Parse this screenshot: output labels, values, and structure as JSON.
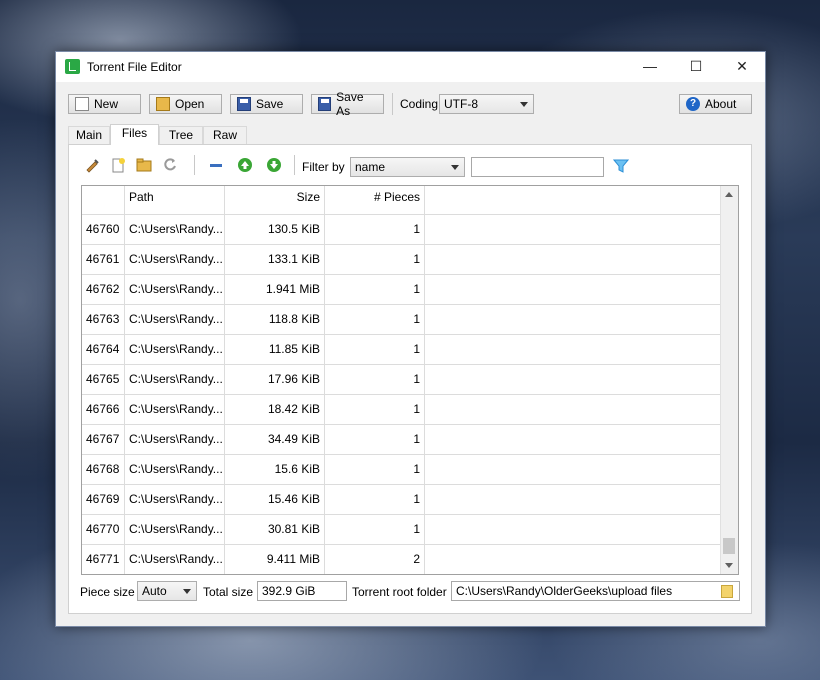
{
  "window": {
    "title": "Torrent File Editor",
    "minimize": "—",
    "maximize": "☐",
    "close": "✕"
  },
  "toolbar": {
    "new_label": "New",
    "open_label": "Open",
    "save_label": "Save",
    "save_as_label": "Save As",
    "coding_label": "Coding",
    "coding_value": "UTF-8",
    "about_label": "About"
  },
  "tabs": [
    "Main",
    "Files",
    "Tree",
    "Raw"
  ],
  "active_tab": "Files",
  "files_toolbar": {
    "filter_label": "Filter by",
    "filter_value": "name",
    "filter_text": ""
  },
  "table": {
    "columns": [
      "",
      "Path",
      "Size",
      "# Pieces"
    ],
    "rows": [
      {
        "id": "46760",
        "path": "C:\\Users\\Randy...",
        "size": "130.5 KiB",
        "pieces": "1"
      },
      {
        "id": "46761",
        "path": "C:\\Users\\Randy...",
        "size": "133.1 KiB",
        "pieces": "1"
      },
      {
        "id": "46762",
        "path": "C:\\Users\\Randy...",
        "size": "1.941 MiB",
        "pieces": "1"
      },
      {
        "id": "46763",
        "path": "C:\\Users\\Randy...",
        "size": "118.8 KiB",
        "pieces": "1"
      },
      {
        "id": "46764",
        "path": "C:\\Users\\Randy...",
        "size": "11.85 KiB",
        "pieces": "1"
      },
      {
        "id": "46765",
        "path": "C:\\Users\\Randy...",
        "size": "17.96 KiB",
        "pieces": "1"
      },
      {
        "id": "46766",
        "path": "C:\\Users\\Randy...",
        "size": "18.42 KiB",
        "pieces": "1"
      },
      {
        "id": "46767",
        "path": "C:\\Users\\Randy...",
        "size": "34.49 KiB",
        "pieces": "1"
      },
      {
        "id": "46768",
        "path": "C:\\Users\\Randy...",
        "size": "15.6 KiB",
        "pieces": "1"
      },
      {
        "id": "46769",
        "path": "C:\\Users\\Randy...",
        "size": "15.46 KiB",
        "pieces": "1"
      },
      {
        "id": "46770",
        "path": "C:\\Users\\Randy...",
        "size": "30.81 KiB",
        "pieces": "1"
      },
      {
        "id": "46771",
        "path": "C:\\Users\\Randy...",
        "size": "9.411 MiB",
        "pieces": "2"
      }
    ]
  },
  "bottom": {
    "piece_size_label": "Piece size",
    "piece_size_value": "Auto",
    "total_size_label": "Total size",
    "total_size_value": "392.9 GiB",
    "root_folder_label": "Torrent root folder",
    "root_folder_value": "C:\\Users\\Randy\\OlderGeeks\\upload files"
  },
  "colors": {
    "accent": "#2aa845",
    "arrow_up": "#3aa635",
    "filter_icon": "#2c8fd6"
  }
}
